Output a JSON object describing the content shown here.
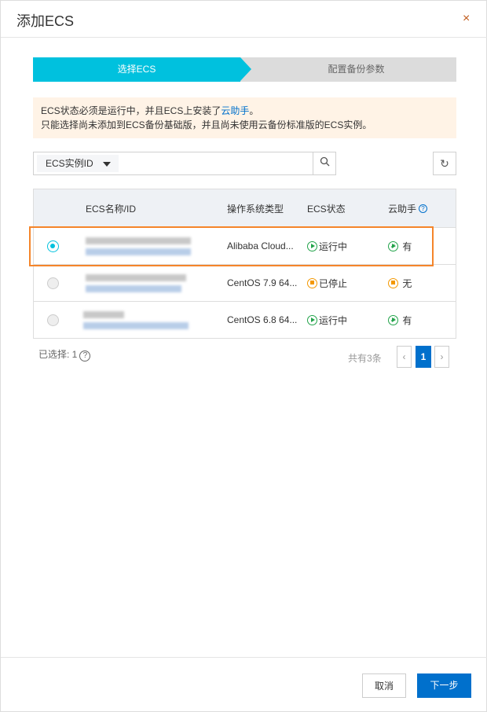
{
  "dialog": {
    "title": "添加ECS",
    "close_icon": "×"
  },
  "steps": [
    {
      "label": "选择ECS",
      "active": true
    },
    {
      "label": "配置备份参数",
      "active": false
    }
  ],
  "notice": {
    "line1_prefix": "ECS状态必须是运行中，并且ECS上安装了",
    "line1_link": "云助手",
    "line1_suffix": "。",
    "line2": "只能选择尚未添加到ECS备份基础版，并且尚未使用云备份标准版的ECS实例。"
  },
  "search": {
    "filter_label": "ECS实例ID",
    "value": ""
  },
  "table": {
    "headers": {
      "name": "ECS名称/ID",
      "os": "操作系统类型",
      "status": "ECS状态",
      "assistant": "云助手"
    },
    "rows": [
      {
        "selected": true,
        "os": "Alibaba Cloud...",
        "status": "运行中",
        "status_type": "running",
        "assistant": "有",
        "assistant_ok": true
      },
      {
        "selected": false,
        "os": "CentOS 7.9 64...",
        "status": "已停止",
        "status_type": "stopped",
        "assistant": "无",
        "assistant_ok": false
      },
      {
        "selected": false,
        "os": "CentOS 6.8 64...",
        "status": "运行中",
        "status_type": "running",
        "assistant": "有",
        "assistant_ok": true
      }
    ]
  },
  "selection": {
    "label": "已选择: 1"
  },
  "pagination": {
    "total": "共有3条",
    "current": "1",
    "prev": "‹",
    "next": "›"
  },
  "footer": {
    "cancel": "取消",
    "next": "下一步"
  }
}
